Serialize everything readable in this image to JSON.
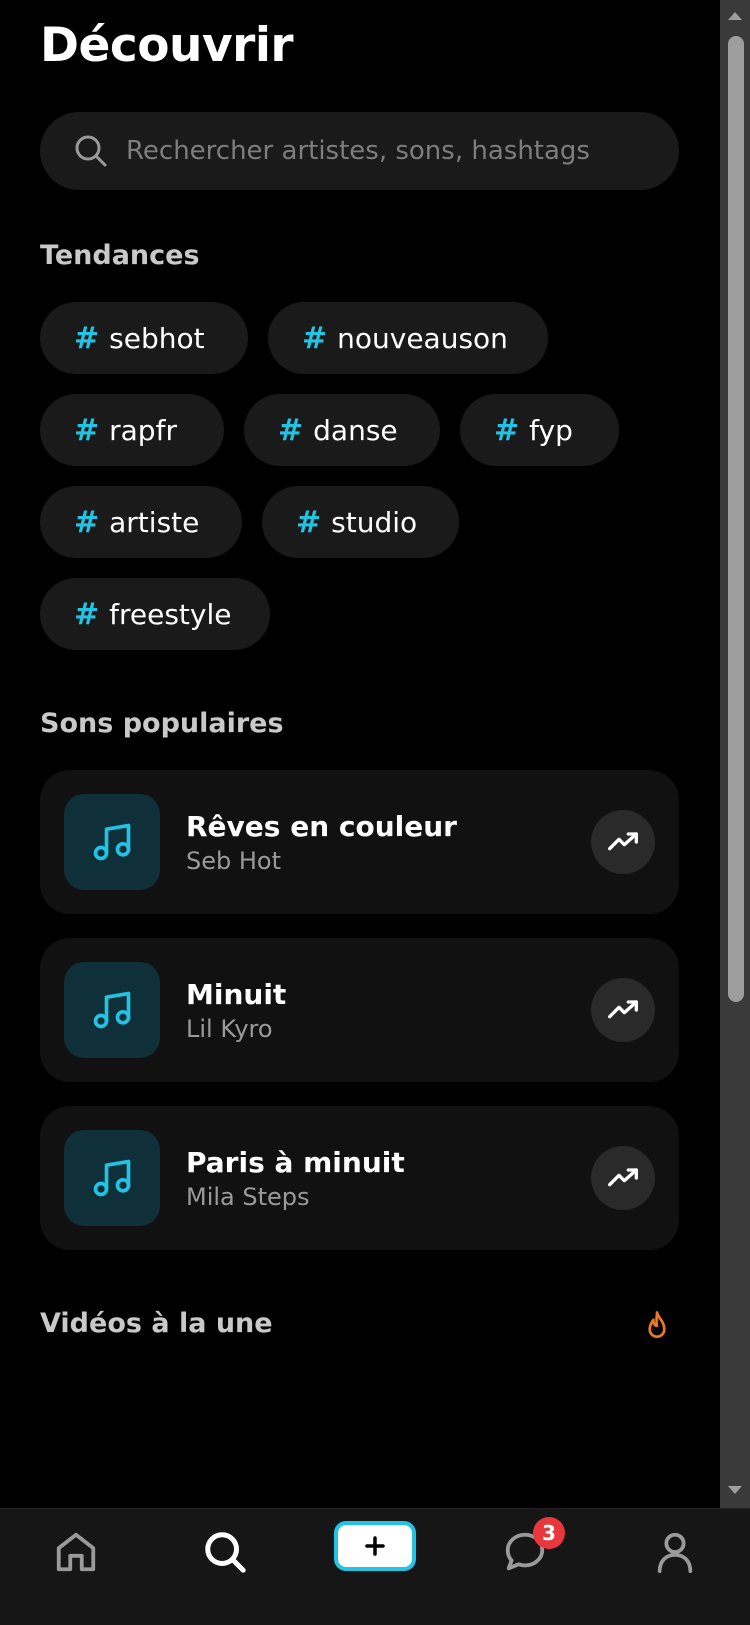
{
  "page": {
    "title": "Découvrir"
  },
  "search": {
    "placeholder": "Rechercher artistes, sons, hashtags",
    "value": ""
  },
  "trending": {
    "heading": "Tendances",
    "tags": [
      "#sebhot",
      "#nouveauson",
      "#rapfr",
      "#danse",
      "#fyp",
      "#artiste",
      "#studio",
      "#freestyle"
    ]
  },
  "popular_sounds": {
    "heading": "Sons populaires",
    "items": [
      {
        "title": "Rêves en couleur",
        "artist": "Seb Hot"
      },
      {
        "title": "Minuit",
        "artist": "Lil Kyro"
      },
      {
        "title": "Paris à minuit",
        "artist": "Mila Steps"
      }
    ]
  },
  "featured_videos": {
    "heading": "Vidéos à la une",
    "icon": "fire-icon"
  },
  "tabbar": {
    "messages_badge": "3"
  },
  "colors": {
    "accent": "#22c3e3",
    "badge": "#e8383d",
    "fire": "#f07a1a"
  }
}
